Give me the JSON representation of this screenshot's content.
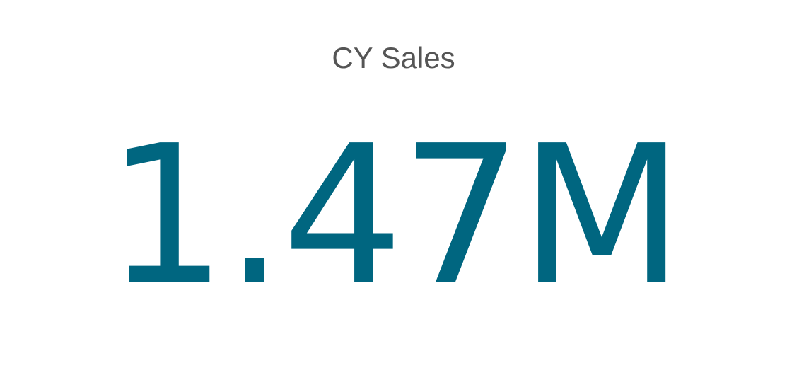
{
  "chart_data": {
    "type": "card",
    "title": "CY Sales",
    "value_label": "1.47M",
    "value": 1470000,
    "color": "#006680"
  }
}
